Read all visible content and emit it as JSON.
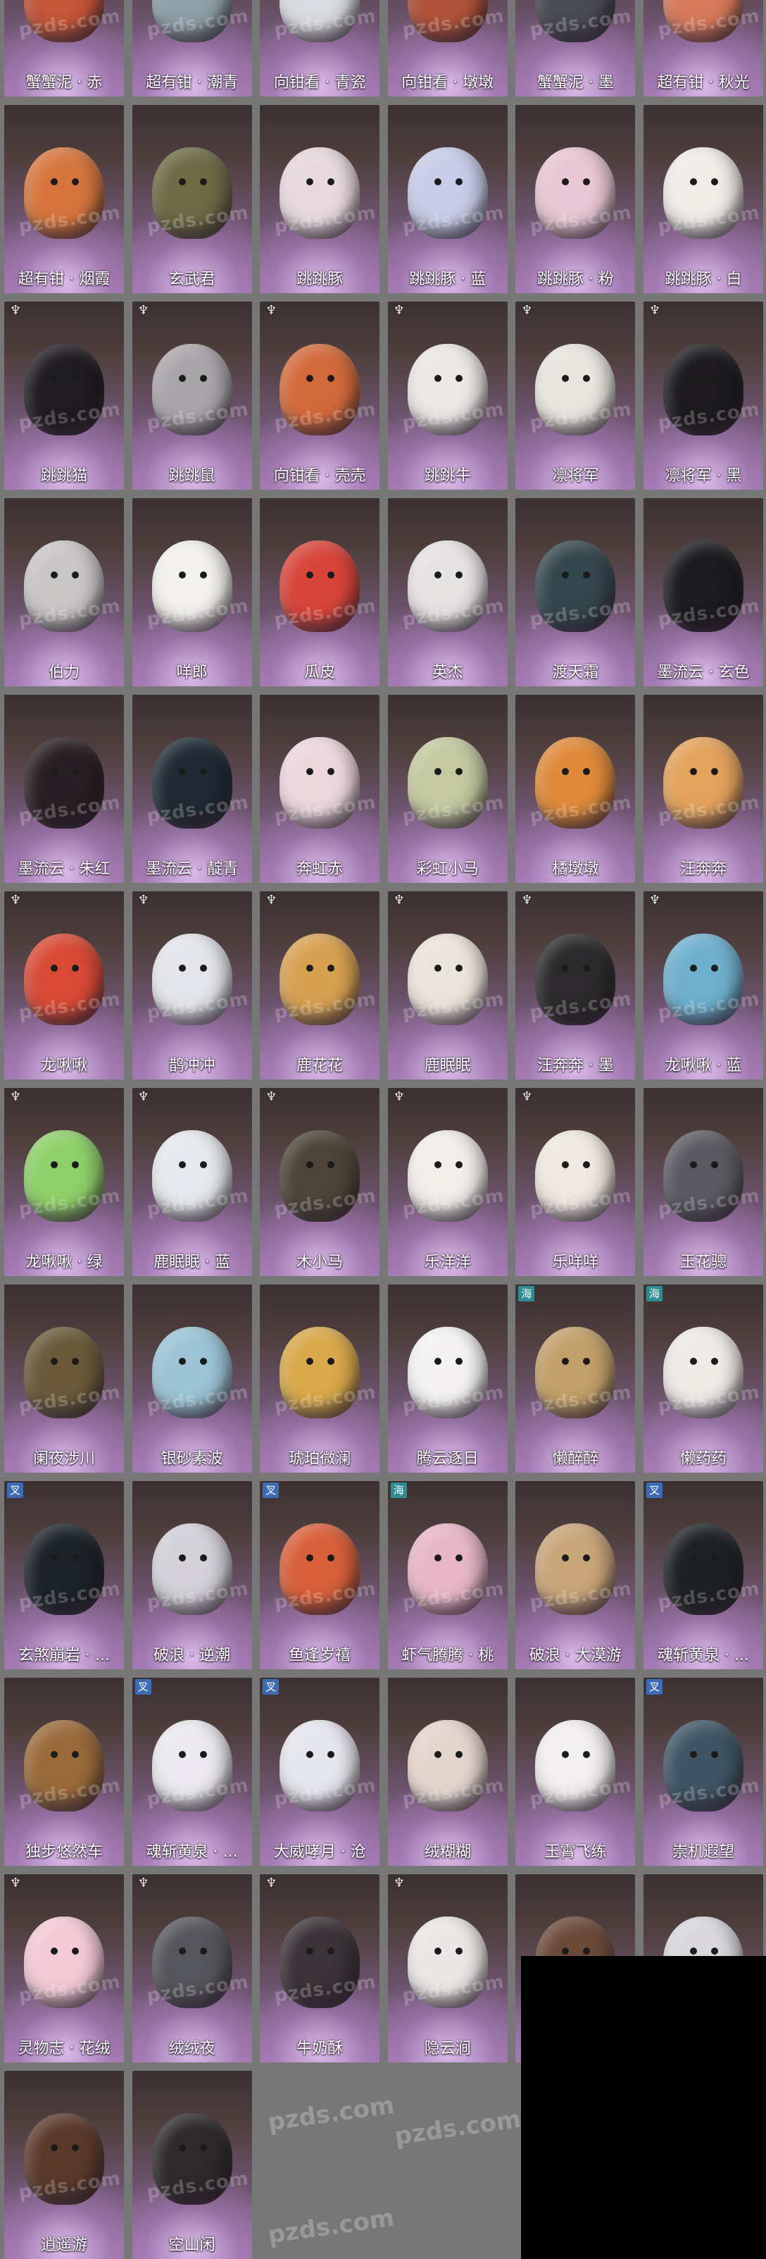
{
  "watermark": "pzds.com",
  "colors": {
    "background": "#777777",
    "name_text": "#ffffff",
    "tag_blue": "#3d6bb5",
    "tag_teal": "#2f8c91",
    "blackout": "#000000"
  },
  "items": [
    {
      "name": "蟹蟹泥 · 赤",
      "color": "#c4563a",
      "tag": ""
    },
    {
      "name": "超有钳 · 潮青",
      "color": "#8fa0a8",
      "tag": ""
    },
    {
      "name": "向钳看 · 青瓷",
      "color": "#d9dbe0",
      "tag": ""
    },
    {
      "name": "向钳看 · 墩墩",
      "color": "#b0523a",
      "tag": ""
    },
    {
      "name": "蟹蟹泥 · 墨",
      "color": "#4a4a55",
      "tag": ""
    },
    {
      "name": "超有钳 · 秋光",
      "color": "#d77a5c",
      "tag": ""
    },
    {
      "name": "超有钳 · 烟霞",
      "color": "#d6763e",
      "tag": ""
    },
    {
      "name": "玄武君",
      "color": "#6d6a45",
      "tag": ""
    },
    {
      "name": "跳跳豚",
      "color": "#e8d9de",
      "tag": ""
    },
    {
      "name": "跳跳豚 · 蓝",
      "color": "#c7cde8",
      "tag": ""
    },
    {
      "name": "跳跳豚 · 粉",
      "color": "#e9c7d4",
      "tag": ""
    },
    {
      "name": "跳跳豚 · 白",
      "color": "#f0ece8",
      "tag": ""
    },
    {
      "name": "跳跳猫",
      "color": "#1f1c22",
      "tag": "♆"
    },
    {
      "name": "跳跳鼠",
      "color": "#a9a6aa",
      "tag": "♆"
    },
    {
      "name": "向钳看 · 壳壳",
      "color": "#d36a3c",
      "tag": "♆"
    },
    {
      "name": "跳跳牛",
      "color": "#ebe8e6",
      "tag": "♆"
    },
    {
      "name": "凛将军",
      "color": "#e9e6e0",
      "tag": "♆"
    },
    {
      "name": "凛将军 · 黑",
      "color": "#1d1b1e",
      "tag": "♆"
    },
    {
      "name": "伯力",
      "color": "#c9c6c6",
      "tag": ""
    },
    {
      "name": "咩郎",
      "color": "#f3f1ee",
      "tag": ""
    },
    {
      "name": "瓜皮",
      "color": "#d8453b",
      "tag": ""
    },
    {
      "name": "英杰",
      "color": "#e6e3e3",
      "tag": ""
    },
    {
      "name": "渡天霜",
      "color": "#35474e",
      "tag": ""
    },
    {
      "name": "墨流云 · 玄色",
      "color": "#1c1b1f",
      "tag": ""
    },
    {
      "name": "墨流云 · 朱红",
      "color": "#2a1f24",
      "tag": ""
    },
    {
      "name": "墨流云 · 靛青",
      "color": "#1f2a35",
      "tag": ""
    },
    {
      "name": "奔虹赤",
      "color": "#ecd7dd",
      "tag": ""
    },
    {
      "name": "彩虹小马",
      "color": "#c4c9a0",
      "tag": ""
    },
    {
      "name": "橘墩墩",
      "color": "#e08a3a",
      "tag": ""
    },
    {
      "name": "汪奔奔",
      "color": "#e3a35c",
      "tag": ""
    },
    {
      "name": "龙啾啾",
      "color": "#d84a36",
      "tag": "♆"
    },
    {
      "name": "鹊冲冲",
      "color": "#e4e6ec",
      "tag": "♆"
    },
    {
      "name": "鹿花花",
      "color": "#d7a152",
      "tag": "♆"
    },
    {
      "name": "鹿眠眠",
      "color": "#ece5dc",
      "tag": "♆"
    },
    {
      "name": "汪奔奔 · 墨",
      "color": "#2c2a2c",
      "tag": "♆"
    },
    {
      "name": "龙啾啾 · 蓝",
      "color": "#6fb0cf",
      "tag": "♆"
    },
    {
      "name": "龙啾啾 · 绿",
      "color": "#8fd06a",
      "tag": "♆"
    },
    {
      "name": "鹿眠眠 · 蓝",
      "color": "#e6e9ee",
      "tag": "♆"
    },
    {
      "name": "木小马",
      "color": "#4e4538",
      "tag": "♆"
    },
    {
      "name": "乐洋洋",
      "color": "#f1eeea",
      "tag": "♆"
    },
    {
      "name": "乐咩咩",
      "color": "#efe9e0",
      "tag": "♆"
    },
    {
      "name": "玉花骢",
      "color": "#5b5a62",
      "tag": ""
    },
    {
      "name": "阑夜涉川",
      "color": "#6a5a3a",
      "tag": ""
    },
    {
      "name": "银砂素波",
      "color": "#9cc4d6",
      "tag": ""
    },
    {
      "name": "琥珀微澜",
      "color": "#d9a94a",
      "tag": ""
    },
    {
      "name": "腾云逐日",
      "color": "#f4f2f2",
      "tag": ""
    },
    {
      "name": "懒醉醉",
      "color": "#c2a06a",
      "tag": "海"
    },
    {
      "name": "懒药药",
      "color": "#eeeae6",
      "tag": "海"
    },
    {
      "name": "玄煞崩岩 · ...",
      "color": "#1c2329",
      "tag": "叉"
    },
    {
      "name": "破浪 · 逆潮",
      "color": "#d3d0d8",
      "tag": ""
    },
    {
      "name": "鱼逢岁禧",
      "color": "#d8603a",
      "tag": "叉"
    },
    {
      "name": "虾气腾腾 · 桃",
      "color": "#e8b7c8",
      "tag": "海"
    },
    {
      "name": "破浪 · 大漠游",
      "color": "#c9a57a",
      "tag": ""
    },
    {
      "name": "魂斩黄泉 · ...",
      "color": "#1f2224",
      "tag": "叉"
    },
    {
      "name": "独步悠然车",
      "color": "#9a6a3a",
      "tag": ""
    },
    {
      "name": "魂斩黄泉 · ...",
      "color": "#eceaf0",
      "tag": "叉"
    },
    {
      "name": "大威哮月 · 沧",
      "color": "#e6e6ee",
      "tag": "叉"
    },
    {
      "name": "绒糊糊",
      "color": "#e5d6cd",
      "tag": ""
    },
    {
      "name": "玉霄飞练",
      "color": "#f2eff0",
      "tag": ""
    },
    {
      "name": "崇机遐望",
      "color": "#3f5565",
      "tag": "叉"
    },
    {
      "name": "灵物志 · 花绒",
      "color": "#f3cad6",
      "tag": "♆"
    },
    {
      "name": "绒绒夜",
      "color": "#55555c",
      "tag": "♆"
    },
    {
      "name": "牛奶酥",
      "color": "#3b3338",
      "tag": "♆"
    },
    {
      "name": "隐云涧",
      "color": "#ebe7e6",
      "tag": "♆"
    },
    {
      "name": "",
      "color": "#6b4a3a",
      "tag": ""
    },
    {
      "name": "",
      "color": "#d9d7dc",
      "tag": ""
    },
    {
      "name": "逍遥游",
      "color": "#5b3a2c",
      "tag": ""
    },
    {
      "name": "空山闲",
      "color": "#2e2a2b",
      "tag": ""
    }
  ]
}
